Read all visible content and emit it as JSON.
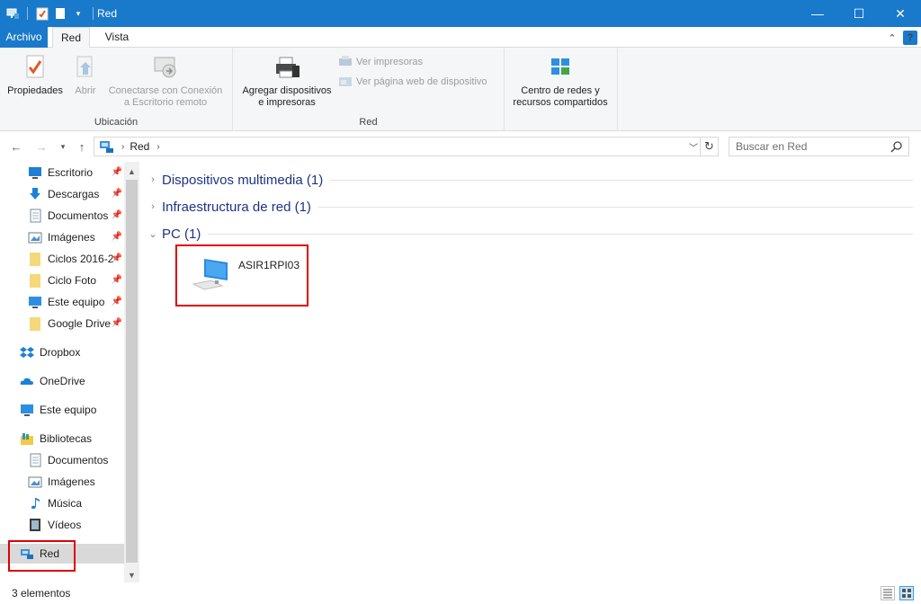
{
  "window": {
    "title": "Red",
    "minimize_glyph": "—",
    "maximize_glyph": "☐",
    "close_glyph": "✕"
  },
  "tabs": {
    "file": "Archivo",
    "active": "Red",
    "view": "Vista"
  },
  "ribbon": {
    "location_group": {
      "label": "Ubicación",
      "properties": "Propiedades",
      "open": "Abrir",
      "remote_line1": "Conectarse con Conexión",
      "remote_line2": "a Escritorio remoto"
    },
    "network_group": {
      "label": "Red",
      "add_devices_line1": "Agregar dispositivos",
      "add_devices_line2": "e impresoras",
      "view_printers": "Ver impresoras",
      "view_device_page": "Ver página web de dispositivo"
    },
    "center_group": {
      "line1": "Centro de redes y",
      "line2": "recursos compartidos"
    }
  },
  "address": {
    "crumb": "Red",
    "search_placeholder": "Buscar en Red"
  },
  "sidebar": {
    "quick_access": [
      {
        "label": "Escritorio",
        "icon": "desktop-icon"
      },
      {
        "label": "Descargas",
        "icon": "download-icon"
      },
      {
        "label": "Documentos",
        "icon": "document-icon"
      },
      {
        "label": "Imágenes",
        "icon": "image-icon"
      },
      {
        "label": "Ciclos 2016-2",
        "icon": "folder-icon"
      },
      {
        "label": "Ciclo Foto",
        "icon": "folder-icon"
      },
      {
        "label": "Este equipo",
        "icon": "computer-icon"
      },
      {
        "label": "Google Drive",
        "icon": "folder-icon"
      }
    ],
    "dropbox": "Dropbox",
    "onedrive": "OneDrive",
    "this_pc": "Este equipo",
    "libraries": "Bibliotecas",
    "library_items": [
      {
        "label": "Documentos",
        "icon": "document-icon"
      },
      {
        "label": "Imágenes",
        "icon": "image-icon"
      },
      {
        "label": "Música",
        "icon": "music-icon"
      },
      {
        "label": "Vídeos",
        "icon": "video-icon"
      }
    ],
    "network": "Red"
  },
  "content": {
    "groups": [
      {
        "title": "Dispositivos multimedia (1)",
        "expanded": false
      },
      {
        "title": "Infraestructura de red (1)",
        "expanded": false
      },
      {
        "title": "PC (1)",
        "expanded": true
      }
    ],
    "pc_item": "ASIR1RPI03"
  },
  "status": {
    "count": "3 elementos"
  },
  "colors": {
    "accent": "#1979ca",
    "highlight_border": "#e00000",
    "group_title": "#1e3287"
  }
}
